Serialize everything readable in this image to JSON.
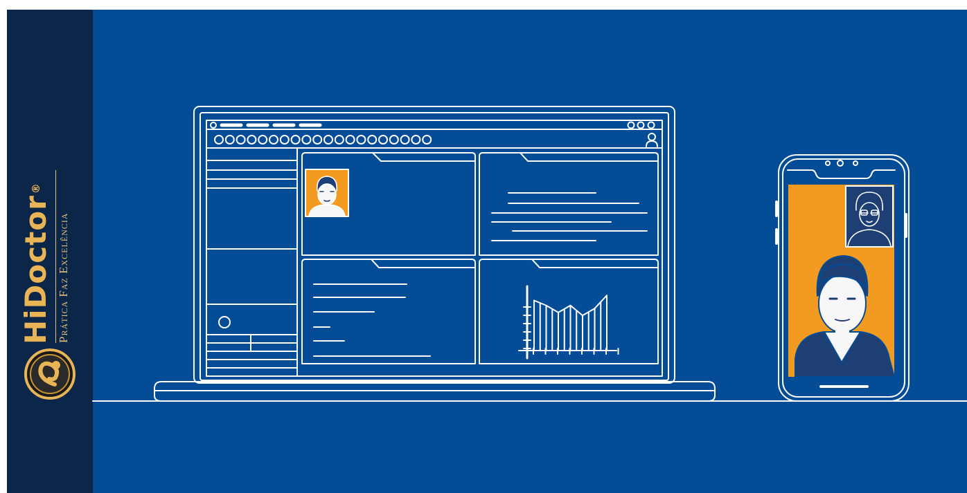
{
  "brand": {
    "name": "HiDoctor",
    "registered_mark": "®",
    "tagline": "Prática Faz Excelência"
  },
  "colors": {
    "background": "#054c97",
    "sidebar": "#0b2648",
    "accent_orange": "#f39a21",
    "line": "#ffffff",
    "brand_gold": "#e9b455"
  },
  "browser": {
    "address_dots": 20
  },
  "chart_data": {
    "type": "bar",
    "values": [
      5,
      4.5,
      3.8,
      4.5,
      3.5,
      4.2,
      5.5
    ]
  }
}
